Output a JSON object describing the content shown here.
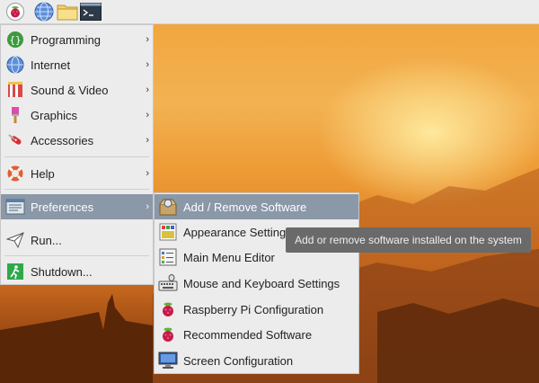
{
  "panel": {
    "items": [
      {
        "icon": "raspberry-icon"
      },
      {
        "icon": "globe-icon"
      },
      {
        "icon": "folder-icon"
      },
      {
        "icon": "terminal-icon"
      }
    ]
  },
  "menu": {
    "items": [
      {
        "label": "Programming",
        "icon": "programming-icon",
        "submenu": true
      },
      {
        "label": "Internet",
        "icon": "globe-icon",
        "submenu": true
      },
      {
        "label": "Sound & Video",
        "icon": "video-icon",
        "submenu": true
      },
      {
        "label": "Graphics",
        "icon": "paintbrush-icon",
        "submenu": true
      },
      {
        "label": "Accessories",
        "icon": "swiss-knife-icon",
        "submenu": true
      },
      {
        "label": "Help",
        "icon": "lifebuoy-icon",
        "submenu": true
      },
      {
        "label": "Preferences",
        "icon": "preferences-icon",
        "submenu": true,
        "active": true
      },
      {
        "label": "Run...",
        "icon": "paper-plane-icon",
        "submenu": false
      },
      {
        "label": "Shutdown...",
        "icon": "exit-icon",
        "submenu": false
      }
    ],
    "arrow": "›"
  },
  "submenu": {
    "items": [
      {
        "label": "Add / Remove Software",
        "icon": "package-icon",
        "active": true
      },
      {
        "label": "Appearance Settings",
        "icon": "appearance-icon"
      },
      {
        "label": "Main Menu Editor",
        "icon": "menu-editor-icon"
      },
      {
        "label": "Mouse and Keyboard Settings",
        "icon": "keyboard-icon"
      },
      {
        "label": "Raspberry Pi Configuration",
        "icon": "raspberry-icon"
      },
      {
        "label": "Recommended Software",
        "icon": "raspberry-icon"
      },
      {
        "label": "Screen Configuration",
        "icon": "monitor-icon"
      }
    ]
  },
  "tooltip": {
    "text": "Add or remove software installed on the system"
  },
  "colors": {
    "highlight": "#8a98a8",
    "menu_bg": "#ececec",
    "tooltip_bg": "#6a6a6a"
  }
}
